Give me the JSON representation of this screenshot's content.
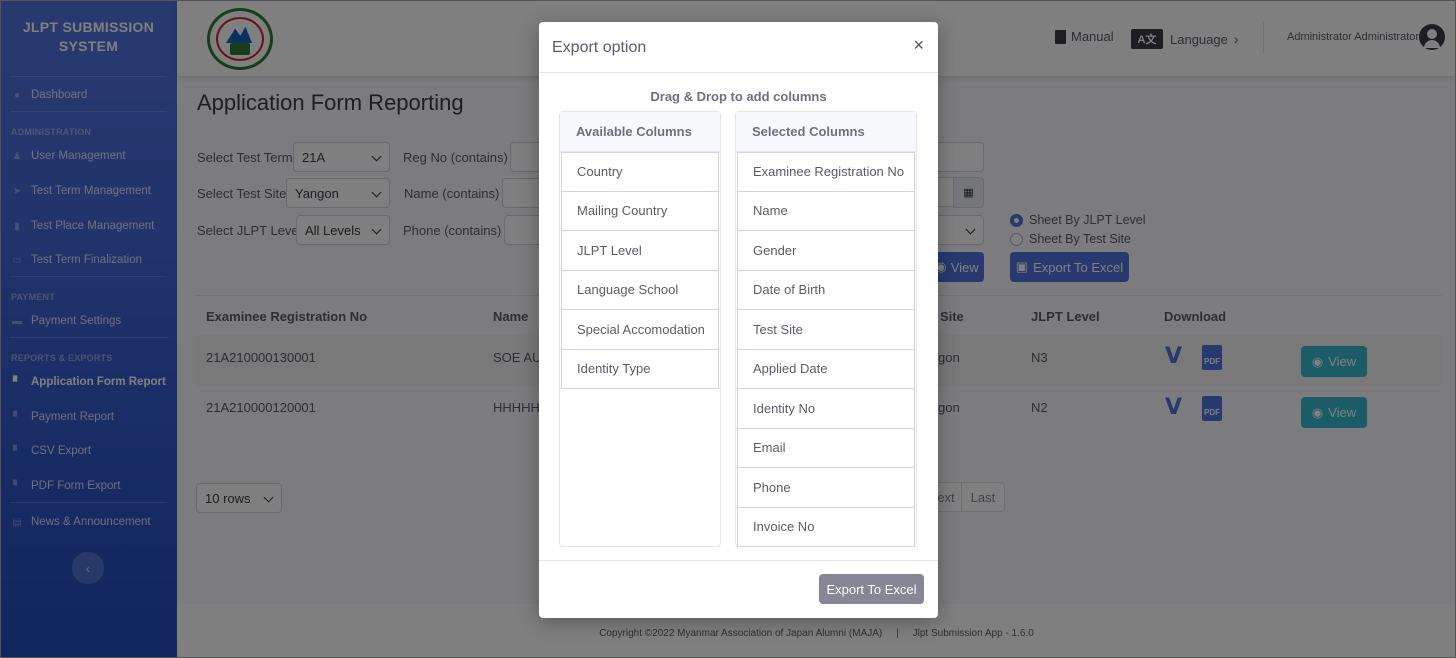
{
  "app": {
    "brand_line1": "JLPT SUBMISSION",
    "brand_line2": "SYSTEM"
  },
  "sidebar": {
    "dashboard": "Dashboard",
    "sections": {
      "administration": "ADMINISTRATION",
      "payment": "PAYMENT",
      "reports": "REPORTS & EXPORTS"
    },
    "items": [
      {
        "label": "User Management",
        "icon": "user-cog-icon"
      },
      {
        "label": "Test Term Management",
        "icon": "paper-plane-icon"
      },
      {
        "label": "Test Place Management",
        "icon": "building-icon"
      },
      {
        "label": "Test Term Finalization",
        "icon": "id-card-icon"
      },
      {
        "label": "Payment Settings",
        "icon": "money-icon"
      },
      {
        "label": "Application Form Report",
        "icon": "file-icon",
        "active": true
      },
      {
        "label": "Payment Report",
        "icon": "file-icon"
      },
      {
        "label": "CSV Export",
        "icon": "file-icon"
      },
      {
        "label": "PDF Form Export",
        "icon": "file-icon"
      },
      {
        "label": "News & Announcement",
        "icon": "newspaper-icon"
      }
    ]
  },
  "topbar": {
    "manual": "Manual",
    "lang_badge": "A文",
    "language": "Language",
    "user": "Administrator Administrator"
  },
  "page": {
    "title": "Application Form Reporting"
  },
  "filters": {
    "test_term_label": "Select Test Term",
    "test_term_value": "21A",
    "test_site_label": "Select Test Site",
    "test_site_value": "Yangon",
    "jlpt_level_label": "Select JLPT Level",
    "jlpt_level_value": "All Levels",
    "reg_no_label": "Reg No (contains)",
    "name_label": "Name (contains)",
    "phone_label": "Phone (contains)",
    "sheet_by_level": "Sheet By JLPT Level",
    "sheet_by_site": "Sheet By Test Site",
    "view_btn": "View",
    "export_btn": "Export To Excel"
  },
  "table": {
    "headers": {
      "reg_no": "Examinee Registration No",
      "name": "Name",
      "site": "t Site",
      "level": "JLPT Level",
      "download": "Download"
    },
    "rows": [
      {
        "reg_no": "21A210000130001",
        "name": "SOE AU",
        "site": "gon",
        "level": "N3",
        "view": "View"
      },
      {
        "reg_no": "21A210000120001",
        "name": "HHHHH",
        "site": "gon",
        "level": "N2",
        "view": "View"
      }
    ]
  },
  "pagination": {
    "rows": "10 rows",
    "next": "ext",
    "last": "Last"
  },
  "footer": {
    "text": "Copyright ©2022 Myanmar Association of Japan Alumni (MAJA)     |     Jlpt Submission App - 1.6.0"
  },
  "modal": {
    "title": "Export option",
    "close": "×",
    "subtitle": "Drag & Drop to add columns",
    "available_title": "Available Columns",
    "available": [
      "Country",
      "Mailing Country",
      "JLPT Level",
      "Language School",
      "Special Accomodation",
      "Identity Type"
    ],
    "selected_title": "Selected Columns",
    "selected": [
      "Examinee Registration No",
      "Name",
      "Gender",
      "Date of Birth",
      "Test Site",
      "Applied Date",
      "Identity No",
      "Email",
      "Phone",
      "Invoice No"
    ],
    "export_btn": "Export To Excel"
  }
}
